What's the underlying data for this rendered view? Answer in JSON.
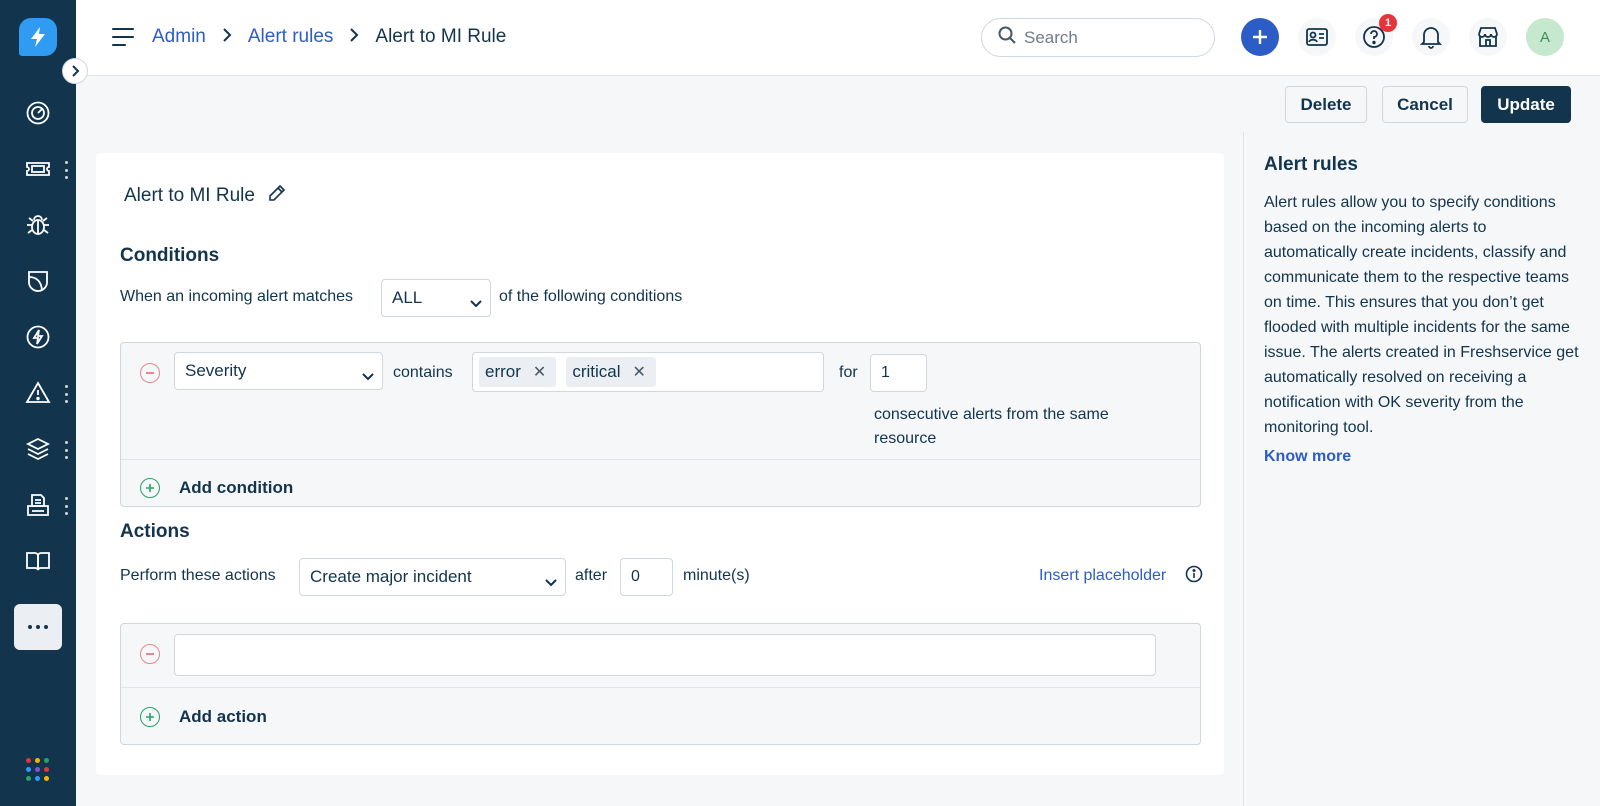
{
  "colors": {
    "sidebar_bg": "#12344d",
    "accent": "#2c5cc5",
    "primary_button": "#12344d",
    "badge": "#e43538",
    "remove": "#e8878a",
    "add": "#28a362"
  },
  "sidebar": {
    "logo_icon": "lightning-logo-icon",
    "items": [
      {
        "icon": "dashboard-icon"
      },
      {
        "icon": "ticket-icon"
      },
      {
        "icon": "bug-icon"
      },
      {
        "icon": "shield-icon"
      },
      {
        "icon": "lightning-icon"
      },
      {
        "icon": "alert-icon"
      },
      {
        "icon": "layers-icon"
      },
      {
        "icon": "printer-icon"
      },
      {
        "icon": "book-icon"
      },
      {
        "icon": "more-icon"
      }
    ],
    "apps_icon": "apps-grid-icon"
  },
  "header": {
    "breadcrumb": [
      {
        "label": "Admin"
      },
      {
        "label": "Alert rules"
      },
      {
        "label": "Alert to MI Rule"
      }
    ],
    "search_placeholder": "Search",
    "help_badge": "1",
    "avatar_initial": "A"
  },
  "toolbar": {
    "delete_label": "Delete",
    "cancel_label": "Cancel",
    "update_label": "Update"
  },
  "rule": {
    "title": "Alert to MI Rule"
  },
  "conditions": {
    "title": "Conditions",
    "prefix_text": "When an incoming alert matches",
    "match_value": "ALL",
    "suffix_text": "of the following conditions",
    "row": {
      "field": "Severity",
      "operator": "contains",
      "tags": [
        "error",
        "critical"
      ],
      "for_label": "for",
      "count": "1",
      "consecutive_text": "consecutive alerts from the same resource"
    },
    "add_label": "Add condition"
  },
  "actions": {
    "title": "Actions",
    "prefix_text": "Perform these actions",
    "action_value": "Create major incident",
    "after_label": "after",
    "minutes_value": "0",
    "minutes_label": "minute(s)",
    "insert_placeholder": "Insert placeholder",
    "add_label": "Add action"
  },
  "info_panel": {
    "title": "Alert rules",
    "description": "Alert rules allow you to specify conditions based on the incoming alerts to automatically create incidents, classify and communicate them to the respective teams on time. This ensures that you don’t get flooded with multiple incidents for the same issue. The alerts created in Freshservice get automatically resolved on receiving a notification with OK severity from the monitoring tool.",
    "link": "Know more"
  }
}
